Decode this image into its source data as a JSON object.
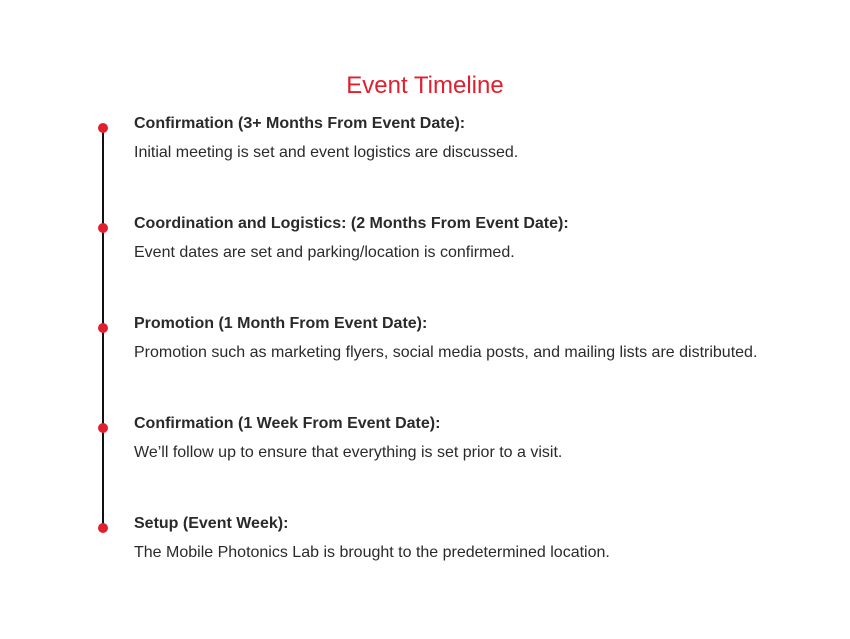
{
  "title": "Event Timeline",
  "colors": {
    "accent": "#e0202e",
    "line": "#111111",
    "text": "#2a2a2a"
  },
  "items": [
    {
      "heading": "Confirmation (3+ Months From Event Date):",
      "description": "Initial meeting is set and event logistics are discussed."
    },
    {
      "heading": "Coordination and Logistics: (2 Months From Event Date):",
      "description": "Event dates are set and parking/location is confirmed."
    },
    {
      "heading": "Promotion (1 Month From Event Date):",
      "description": "Promotion such as marketing flyers, social media posts, and mailing lists are distributed."
    },
    {
      "heading": "Confirmation (1 Week From Event Date):",
      "description": "We’ll follow up to ensure that everything is set prior to a visit."
    },
    {
      "heading": "Setup (Event Week):",
      "description": "The Mobile Photonics Lab is brought to the predetermined location."
    }
  ]
}
